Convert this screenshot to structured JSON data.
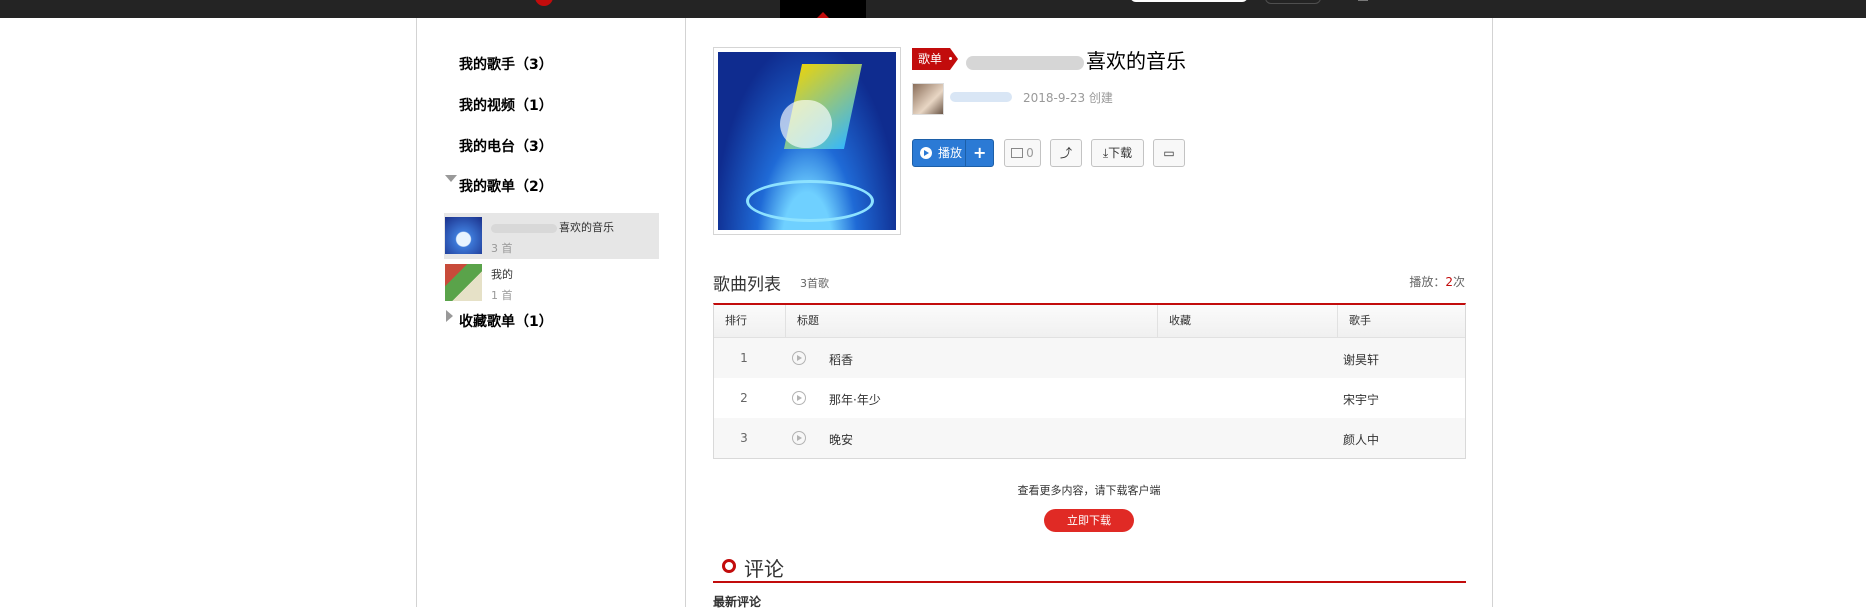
{
  "sidebar": {
    "heads": [
      "我的歌手（3）",
      "我的视频（1）",
      "我的电台（3）",
      "我的歌单（2）",
      "收藏歌单（1）"
    ],
    "playlists": [
      {
        "name": "喜欢的音乐",
        "count": "3 首"
      },
      {
        "name": "我的",
        "count": "1 首"
      }
    ]
  },
  "playlist": {
    "tag": "歌单",
    "title": "喜欢的音乐",
    "created": "2018-9-23 创建",
    "buttons": {
      "play": "播放",
      "add": "+",
      "fav": "0",
      "download": "下载"
    }
  },
  "songs": {
    "title": "歌曲列表",
    "count": "3首歌",
    "plays_label": "播放：",
    "plays": "2",
    "plays_unit": "次",
    "columns": [
      "排行",
      "标题",
      "收藏",
      "歌手"
    ],
    "rows": [
      {
        "rank": "1",
        "title": "稻香",
        "artist": "谢昊轩"
      },
      {
        "rank": "2",
        "title": "那年·年少",
        "artist": "宋宇宁"
      },
      {
        "rank": "3",
        "title": "晚安",
        "artist": "颜人中"
      }
    ]
  },
  "footer": {
    "more_tip": "查看更多内容，请下载客户端",
    "download_now": "立即下载",
    "comments_title": "评论",
    "latest_title": "最新评论"
  },
  "colors": {
    "accent": "#c20c0c",
    "play_button": "#2b7ad5"
  },
  "icons": [
    "play-icon",
    "add-icon",
    "favorite-icon",
    "share-icon",
    "download-icon",
    "comment-icon"
  ]
}
